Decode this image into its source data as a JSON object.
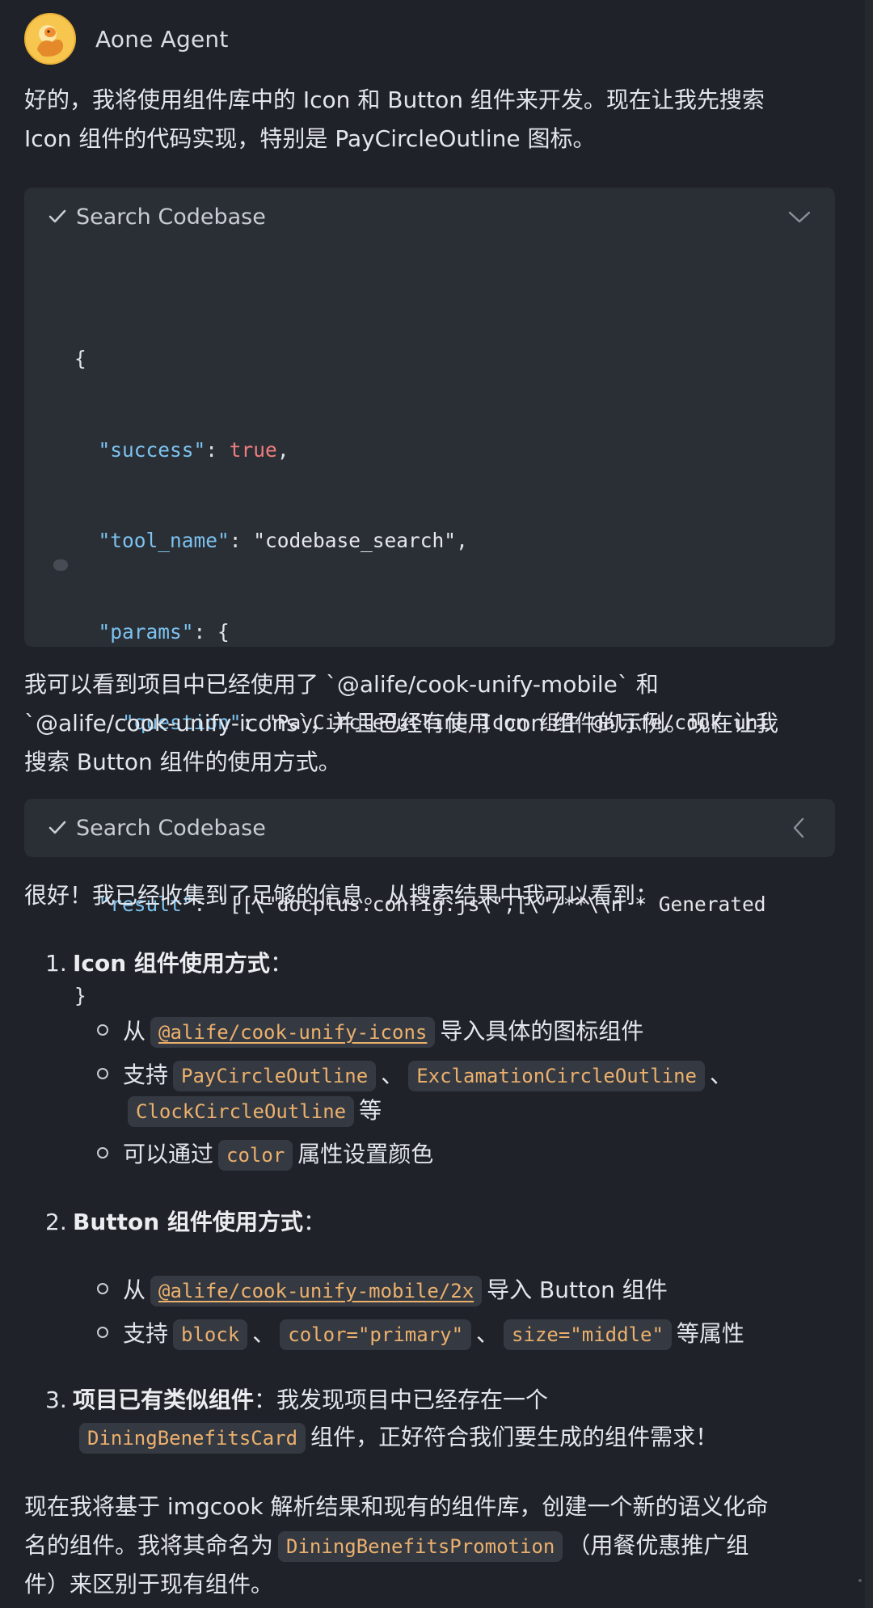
{
  "agent": {
    "name": "Aone Agent",
    "avatar": "agent-avatar-duck"
  },
  "messages": {
    "intro": {
      "line1": "好的，我将使用组件库中的 Icon 和 Button 组件来开发。现在让我先搜索",
      "line2": "Icon 组件的代码实现，特别是 PayCircleOutline 图标。"
    },
    "tool1": {
      "status_icon": "check-icon",
      "title": "Search Codebase",
      "toggle_icon": "chevron-down-icon",
      "code": {
        "open_brace": "{",
        "success_key": "\"success\"",
        "success_val": "true",
        "tool_name_key": "\"tool_name\"",
        "tool_name_val": "\"codebase_search\"",
        "params_key": "\"params\"",
        "question_key": "\"question\"",
        "question_val": "\"PayCircleOutline Icon 组件 @alife/cook-uni",
        "params_close": "},",
        "result_key": "\"result\"",
        "result_val": "\"[[\\\"docplus.config.js\\\",[\\\"/**\\\\n * Generated",
        "close_brace": "}"
      }
    },
    "middle": {
      "line1": "我可以看到项目中已经使用了 `@alife/cook-unify-mobile` 和",
      "line2": "`@alife/cook-unify-icons`，并且已经有使用 Icon 组件的示例。现在让我",
      "line3": "搜索 Button 组件的使用方式。"
    },
    "tool2": {
      "status_icon": "check-icon",
      "title": "Search Codebase",
      "toggle_icon": "chevron-left-icon"
    },
    "summary_intro": "很好！我已经收集到了足够的信息。从搜索结果中我可以看到：",
    "list": {
      "item1": {
        "num": "1.",
        "title": "Icon 组件使用方式",
        "colon": "：",
        "b1_from": "从",
        "b1_code": "@alife/cook-unify-icons",
        "b1_rest": "导入具体的图标组件",
        "b2_support": "支持",
        "b2_code1": "PayCircleOutline",
        "b2_sep1": "、",
        "b2_code2": "ExclamationCircleOutline",
        "b2_sep2": "、",
        "b2_code3": "ClockCircleOutline",
        "b2_rest": "等",
        "b3_pre": "可以通过",
        "b3_code": "color",
        "b3_rest": "属性设置颜色"
      },
      "item2": {
        "num": "2.",
        "title": "Button 组件使用方式",
        "colon": "：",
        "b1_from": "从",
        "b1_code": "@alife/cook-unify-mobile/2x",
        "b1_rest": "导入 Button 组件",
        "b2_support": "支持",
        "b2_code1": "block",
        "b2_sep1": "、",
        "b2_code2": "color=\"primary\"",
        "b2_sep2": "、",
        "b2_code3": "size=\"middle\"",
        "b2_rest": "等属性"
      },
      "item3": {
        "num": "3.",
        "title": "项目已有类似组件",
        "rest": "：我发现项目中已经存在一个",
        "code": "DiningBenefitsCard",
        "rest2": "组件，正好符合我们要生成的组件需求！"
      }
    },
    "closing": {
      "line1": "现在我将基于 imgcook 解析结果和现有的组件库，创建一个新的语义化命",
      "line2_pre": "名的组件。我将其命名为",
      "line2_code": "DiningBenefitsPromotion",
      "line2_post": "（用餐优惠推广组",
      "line3": "件）来区别于现有组件。"
    }
  },
  "colors": {
    "background": "#1f2228",
    "card": "#2a2e35",
    "inline_code_text": "#ecb06d",
    "json_key": "#7cc3f0",
    "json_bool": "#ef7e7e"
  }
}
